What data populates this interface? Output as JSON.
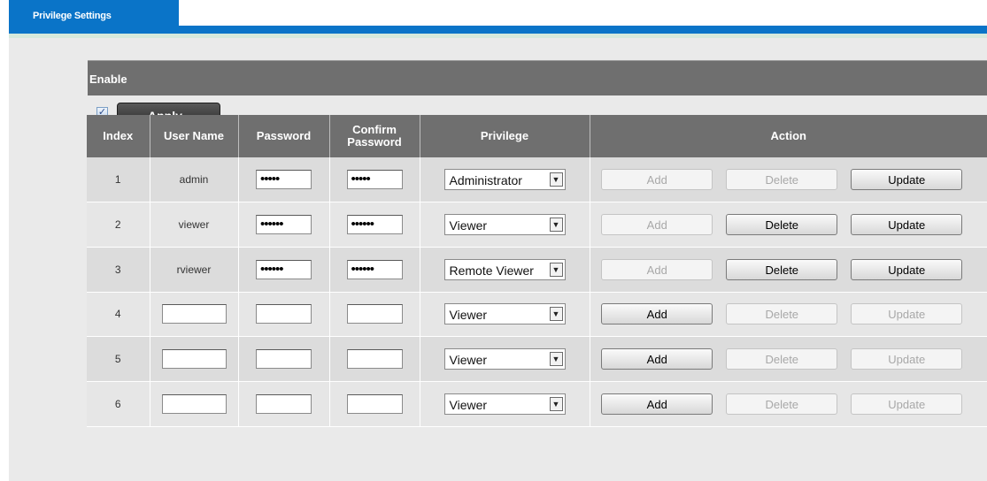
{
  "tab": {
    "label": "Privilege Settings"
  },
  "enable": {
    "section_label": "Enable",
    "checked_mark": "✓",
    "apply_label": "Apply"
  },
  "table": {
    "headers": {
      "index": "Index",
      "user_name": "User Name",
      "password_line1": "Password",
      "confirm_line1": "Confirm",
      "confirm_line2": "Password",
      "privilege": "Privilege",
      "action": "Action"
    },
    "rows": [
      {
        "index": "1",
        "user_name": "admin",
        "password": "•••••",
        "confirm": "•••••",
        "privilege": "Administrator",
        "add": "Add",
        "delete": "Delete",
        "update": "Update",
        "add_enabled": false,
        "delete_enabled": false,
        "update_enabled": true
      },
      {
        "index": "2",
        "user_name": "viewer",
        "password": "••••••",
        "confirm": "••••••",
        "privilege": "Viewer",
        "add": "Add",
        "delete": "Delete",
        "update": "Update",
        "add_enabled": false,
        "delete_enabled": true,
        "update_enabled": true
      },
      {
        "index": "3",
        "user_name": "rviewer",
        "password": "••••••",
        "confirm": "••••••",
        "privilege": "Remote Viewer",
        "add": "Add",
        "delete": "Delete",
        "update": "Update",
        "add_enabled": false,
        "delete_enabled": true,
        "update_enabled": true
      },
      {
        "index": "4",
        "user_name": "",
        "password": "",
        "confirm": "",
        "privilege": "Viewer",
        "add": "Add",
        "delete": "Delete",
        "update": "Update",
        "add_enabled": true,
        "delete_enabled": false,
        "update_enabled": false
      },
      {
        "index": "5",
        "user_name": "",
        "password": "",
        "confirm": "",
        "privilege": "Viewer",
        "add": "Add",
        "delete": "Delete",
        "update": "Update",
        "add_enabled": true,
        "delete_enabled": false,
        "update_enabled": false
      },
      {
        "index": "6",
        "user_name": "",
        "password": "",
        "confirm": "",
        "privilege": "Viewer",
        "add": "Add",
        "delete": "Delete",
        "update": "Update",
        "add_enabled": true,
        "delete_enabled": false,
        "update_enabled": false
      }
    ]
  },
  "colors": {
    "tab_blue": "#0a74c8",
    "header_gray": "#6f6f6f",
    "panel_bg": "#eaeaea"
  },
  "icons": {
    "dropdown": "chevron-down-icon",
    "checkbox": "check-icon"
  }
}
